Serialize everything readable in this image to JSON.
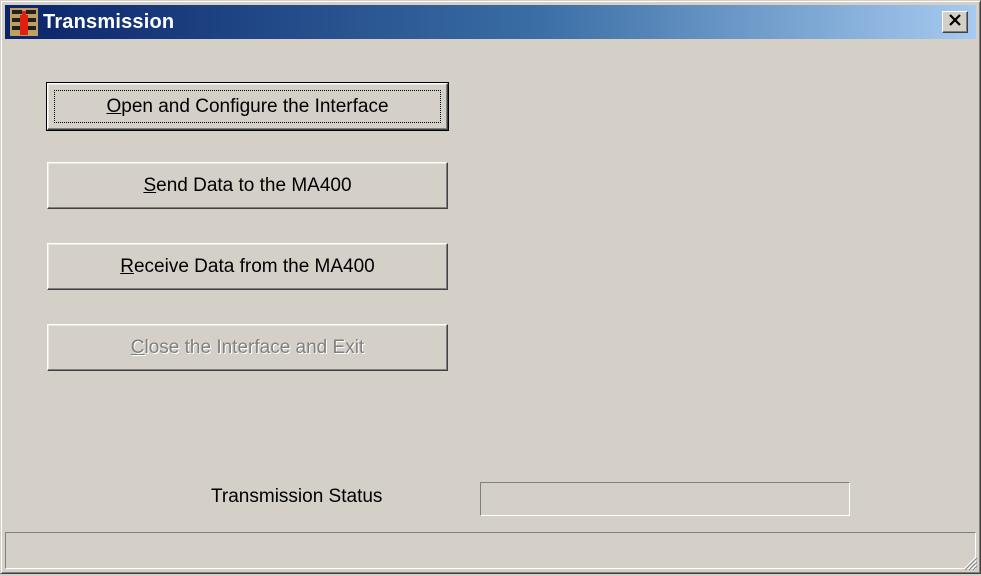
{
  "window": {
    "title": "Transmission",
    "close_glyph": "✕",
    "icon": "app-icon"
  },
  "buttons": [
    {
      "hotkey": "O",
      "rest": "pen and Configure the Interface",
      "enabled": true,
      "default": true
    },
    {
      "hotkey": "S",
      "rest": "end Data to the MA400",
      "enabled": true,
      "default": false
    },
    {
      "hotkey": "R",
      "rest": "eceive Data from the MA400",
      "enabled": true,
      "default": false
    },
    {
      "hotkey": "C",
      "rest": "lose the Interface and Exit",
      "enabled": false,
      "default": false
    }
  ],
  "status": {
    "label": "Transmission Status",
    "value": ""
  },
  "statusbar": {
    "text": ""
  }
}
